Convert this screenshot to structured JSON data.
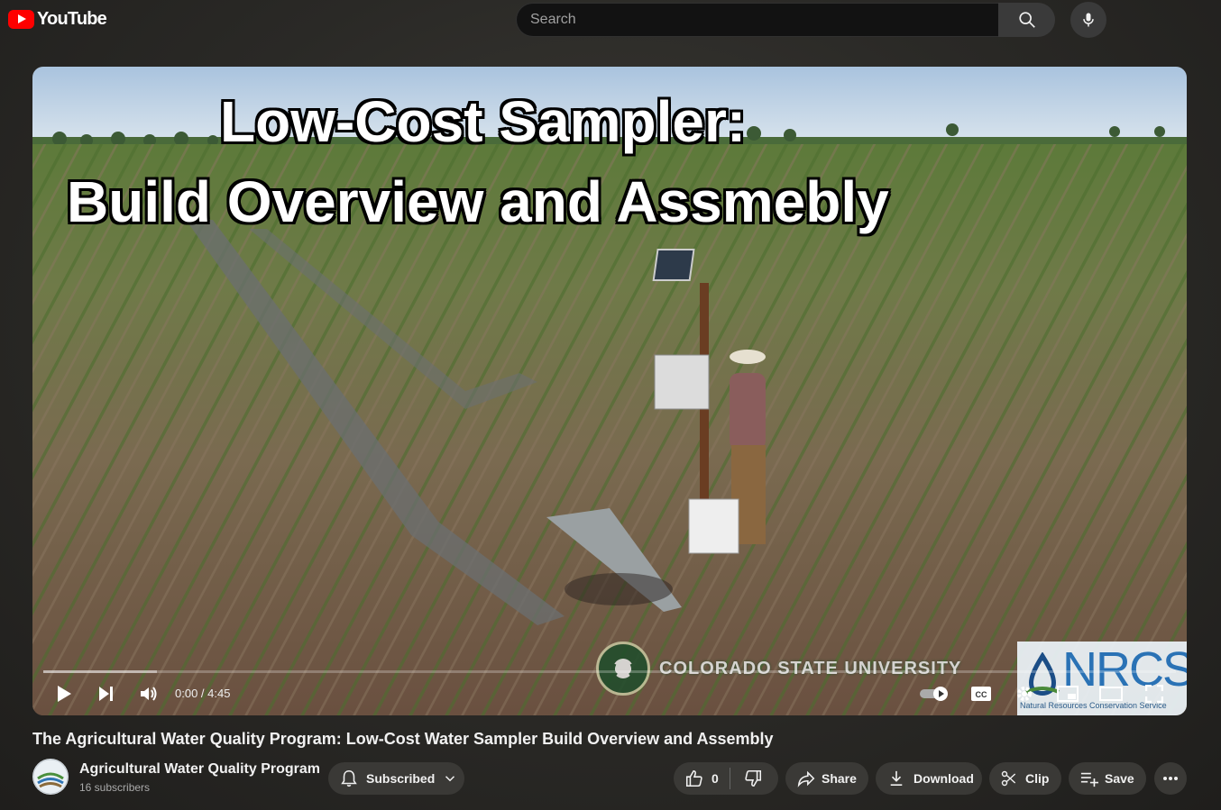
{
  "header": {
    "logo_text": "YouTube",
    "search_placeholder": "Search"
  },
  "player": {
    "overlay_line1": "Low-Cost Sampler:",
    "overlay_line2": "Build Overview and Assmebly",
    "watermark_left": "COLORADO STATE UNIVERSITY",
    "watermark_right_big": "NRCS",
    "watermark_right_small": "Natural Resources Conservation Service",
    "time_display": "0:00 / 4:45",
    "progress": 0.0,
    "buffered": 0.1
  },
  "video": {
    "title": "The Agricultural Water Quality Program: Low-Cost Water Sampler Build Overview and Assembly"
  },
  "channel": {
    "name": "Agricultural Water Quality Program",
    "subscribers": "16 subscribers"
  },
  "actions": {
    "subscribed_label": "Subscribed",
    "like_count": "0",
    "share_label": "Share",
    "download_label": "Download",
    "clip_label": "Clip",
    "save_label": "Save"
  },
  "colors": {
    "brand_red": "#ff0000",
    "csu_green": "#1e4d2b",
    "nrcs_blue": "#2a72b5"
  }
}
